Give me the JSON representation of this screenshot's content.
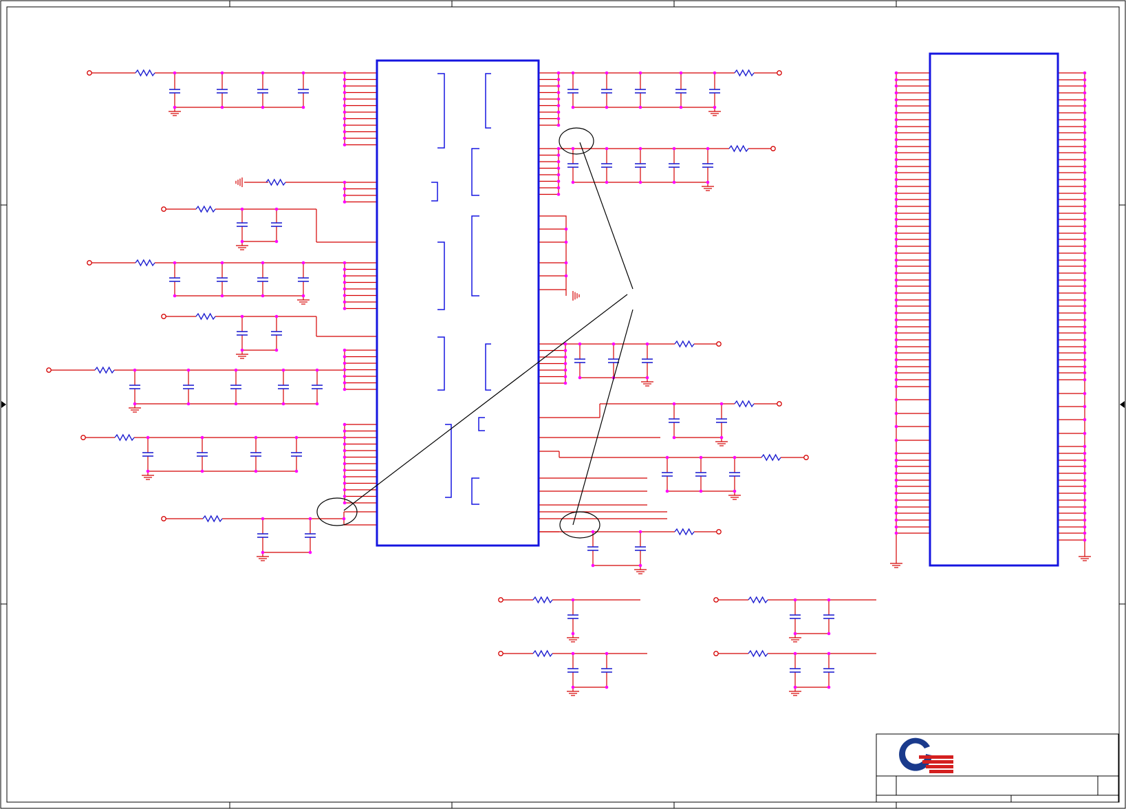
{
  "colors": {
    "frame": "#000000",
    "net_wire": "#d40000",
    "junction": "#ff00ff",
    "resistor": "#1f1fd0",
    "capacitor": "#1f1fd0",
    "ic_outline": "#1515e0",
    "ground": "#d40000",
    "callout": "#000000",
    "logo_blue": "#1a3a8c",
    "logo_red": "#d42020"
  },
  "sheet": {
    "zone_arrows": [
      "left-arrow-icon",
      "right-arrow-icon"
    ]
  },
  "title_block": {
    "logo": "company-logo-icon"
  }
}
